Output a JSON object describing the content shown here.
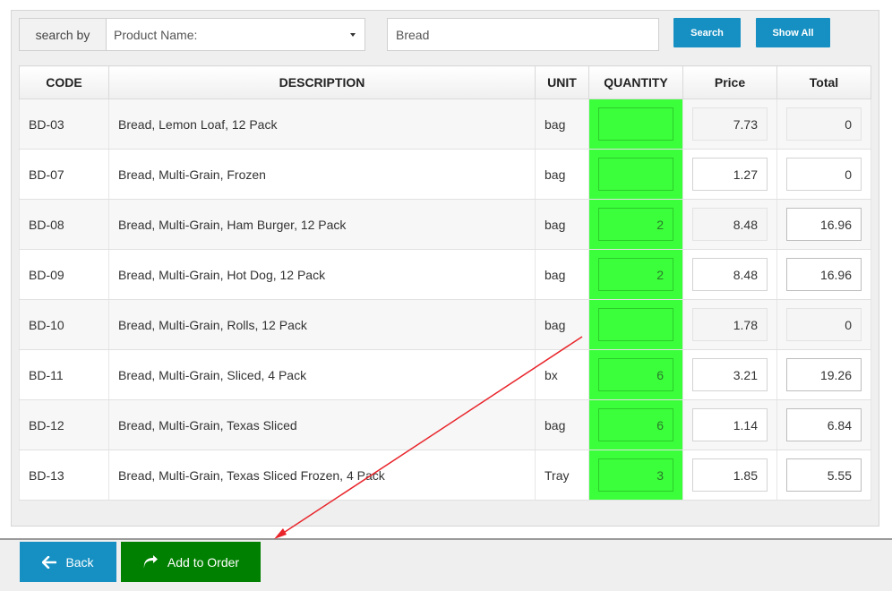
{
  "search": {
    "by_label": "search by",
    "field_selected": "Product Name:",
    "query": "Bread",
    "search_button": "Search",
    "show_all_button": "Show All"
  },
  "table": {
    "headers": [
      "CODE",
      "DESCRIPTION",
      "UNIT",
      "QUANTITY",
      "Price",
      "Total"
    ],
    "rows": [
      {
        "code": "BD-03",
        "description": "Bread, Lemon Loaf, 12 Pack",
        "unit": "bag",
        "quantity": "",
        "price": "7.73",
        "total": "0"
      },
      {
        "code": "BD-07",
        "description": "Bread, Multi-Grain, Frozen",
        "unit": "bag",
        "quantity": "",
        "price": "1.27",
        "total": "0"
      },
      {
        "code": "BD-08",
        "description": "Bread, Multi-Grain, Ham Burger, 12 Pack",
        "unit": "bag",
        "quantity": "2",
        "price": "8.48",
        "total": "16.96"
      },
      {
        "code": "BD-09",
        "description": "Bread, Multi-Grain, Hot Dog, 12 Pack",
        "unit": "bag",
        "quantity": "2",
        "price": "8.48",
        "total": "16.96"
      },
      {
        "code": "BD-10",
        "description": "Bread, Multi-Grain, Rolls, 12 Pack",
        "unit": "bag",
        "quantity": "",
        "price": "1.78",
        "total": "0"
      },
      {
        "code": "BD-11",
        "description": "Bread, Multi-Grain, Sliced, 4 Pack",
        "unit": "bx",
        "quantity": "6",
        "price": "3.21",
        "total": "19.26"
      },
      {
        "code": "BD-12",
        "description": "Bread, Multi-Grain, Texas Sliced",
        "unit": "bag",
        "quantity": "6",
        "price": "1.14",
        "total": "6.84"
      },
      {
        "code": "BD-13",
        "description": "Bread, Multi-Grain, Texas Sliced Frozen, 4 Pack",
        "unit": "Tray",
        "quantity": "3",
        "price": "1.85",
        "total": "5.55"
      }
    ]
  },
  "footer": {
    "back_label": "Back",
    "add_to_order_label": "Add to Order"
  },
  "colors": {
    "accent_blue": "#1690c3",
    "add_green": "#008000",
    "quantity_highlight": "#3bff3b",
    "annotation_arrow": "#e8252b"
  }
}
